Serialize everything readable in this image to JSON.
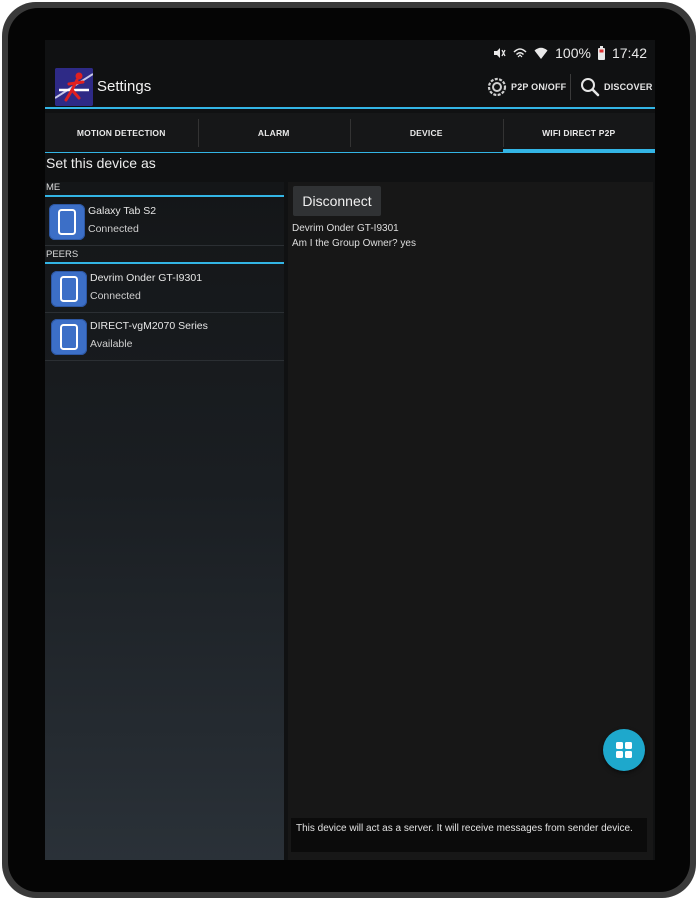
{
  "statusbar": {
    "battery": "100%",
    "time": "17:42",
    "icons": [
      "mute-icon",
      "wifi-direct-icon",
      "wifi-icon",
      "battery-icon"
    ]
  },
  "actionbar": {
    "title": "Settings",
    "p2p_toggle_label": "P2P ON/OFF",
    "discover_label": "DISCOVER",
    "app_icon": "motion-person-icon"
  },
  "tabs": [
    {
      "label": "MOTION DETECTION",
      "selected": false
    },
    {
      "label": "ALARM",
      "selected": false
    },
    {
      "label": "DEVICE",
      "selected": false
    },
    {
      "label": "WIFI DIRECT P2P",
      "selected": true
    }
  ],
  "section_heading": "Set this device as",
  "me": {
    "header": "ME",
    "device": {
      "name": "Galaxy Tab S2",
      "status": "Connected",
      "icon": "tablet-icon"
    }
  },
  "peers": {
    "header": "PEERS",
    "devices": [
      {
        "name": "Devrim Onder GT-I9301",
        "status": "Connected",
        "icon": "tablet-icon"
      },
      {
        "name": "DIRECT-vgM2070 Series",
        "status": "Available",
        "icon": "tablet-icon"
      }
    ]
  },
  "details": {
    "disconnect_label": "Disconnect",
    "peer_line": "Devrim Onder GT-I9301",
    "group_owner_line": "Am I the Group Owner? yes",
    "status_message": "This device will act as a server. It will receive messages from sender device.",
    "fab_icon": "grid-icon"
  },
  "colors": {
    "accent": "#33b5e5",
    "fab": "#1ea8cc",
    "device_icon": "#3c6fc7",
    "app_icon_bg": "#2e2a86"
  }
}
